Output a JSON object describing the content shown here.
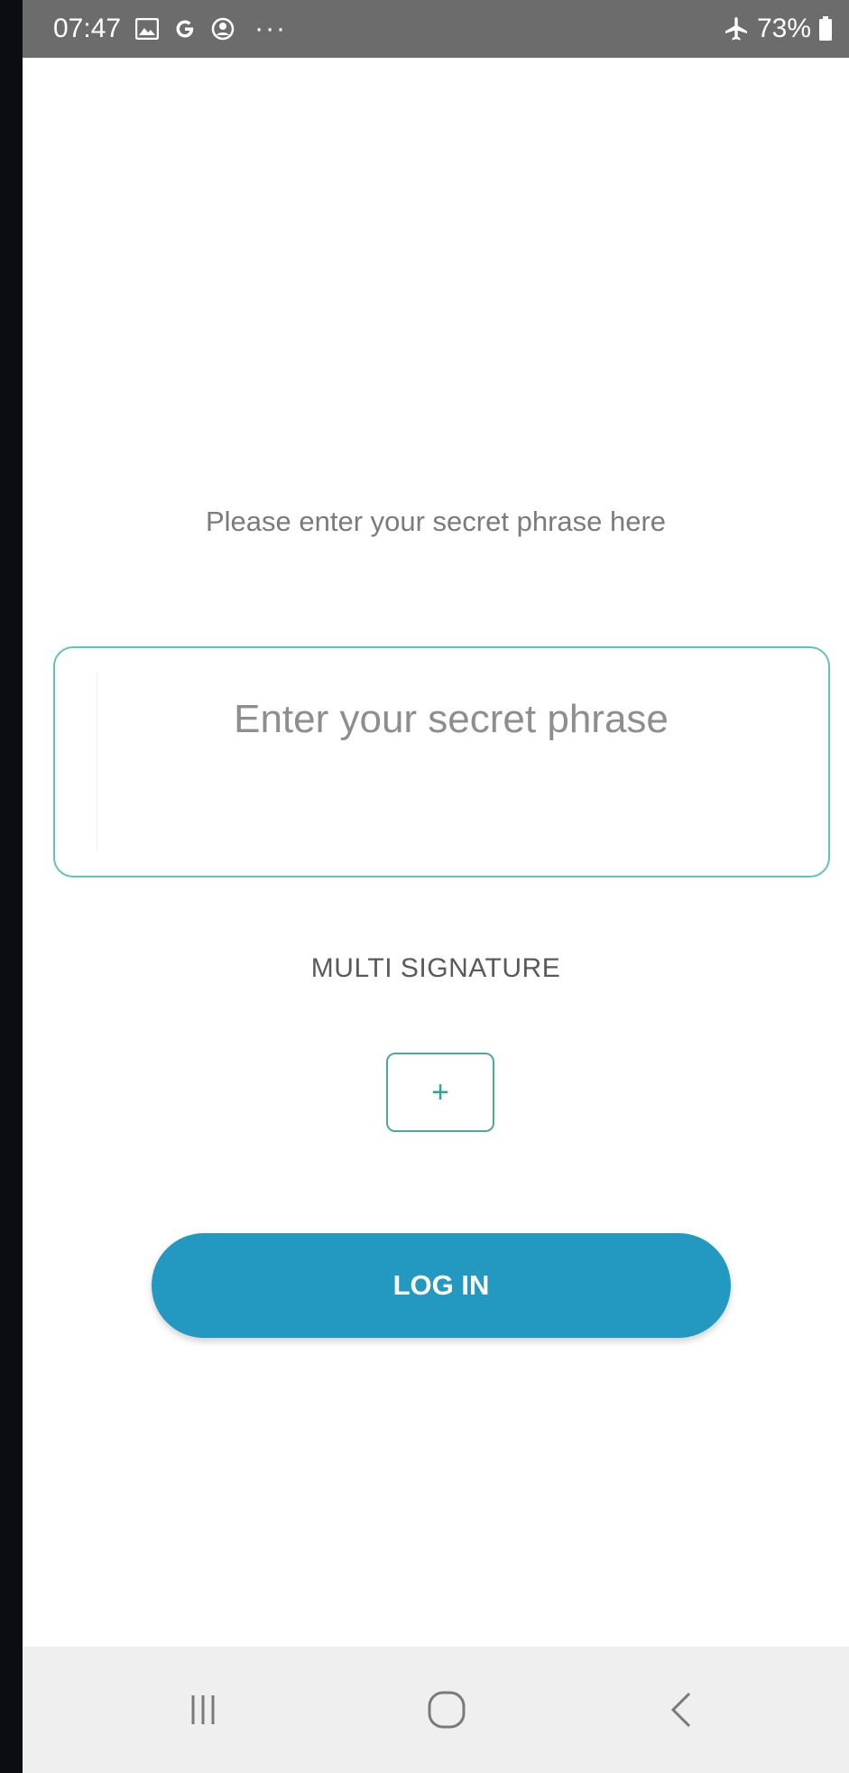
{
  "status_bar": {
    "time": "07:47",
    "battery": "73%",
    "icons": [
      "gallery-icon",
      "google-icon",
      "account-icon",
      "more-dots-icon",
      "airplane-icon",
      "battery-icon"
    ],
    "more_dots": "···"
  },
  "login": {
    "prompt": "Please enter your secret phrase here",
    "phrase_placeholder": "Enter your secret phrase",
    "multi_signature_label": "MULTI  SIGNATURE",
    "add_button_label": "+",
    "login_button_label": "LOG IN"
  },
  "nav_bar": {
    "icons": [
      "recent-apps-icon",
      "home-icon",
      "back-icon"
    ]
  },
  "colors": {
    "accent_teal": "#5ec6b1",
    "primary_blue": "#2399c2",
    "status_bar_bg": "#6c6c6c",
    "nav_bar_bg": "#efefef"
  }
}
